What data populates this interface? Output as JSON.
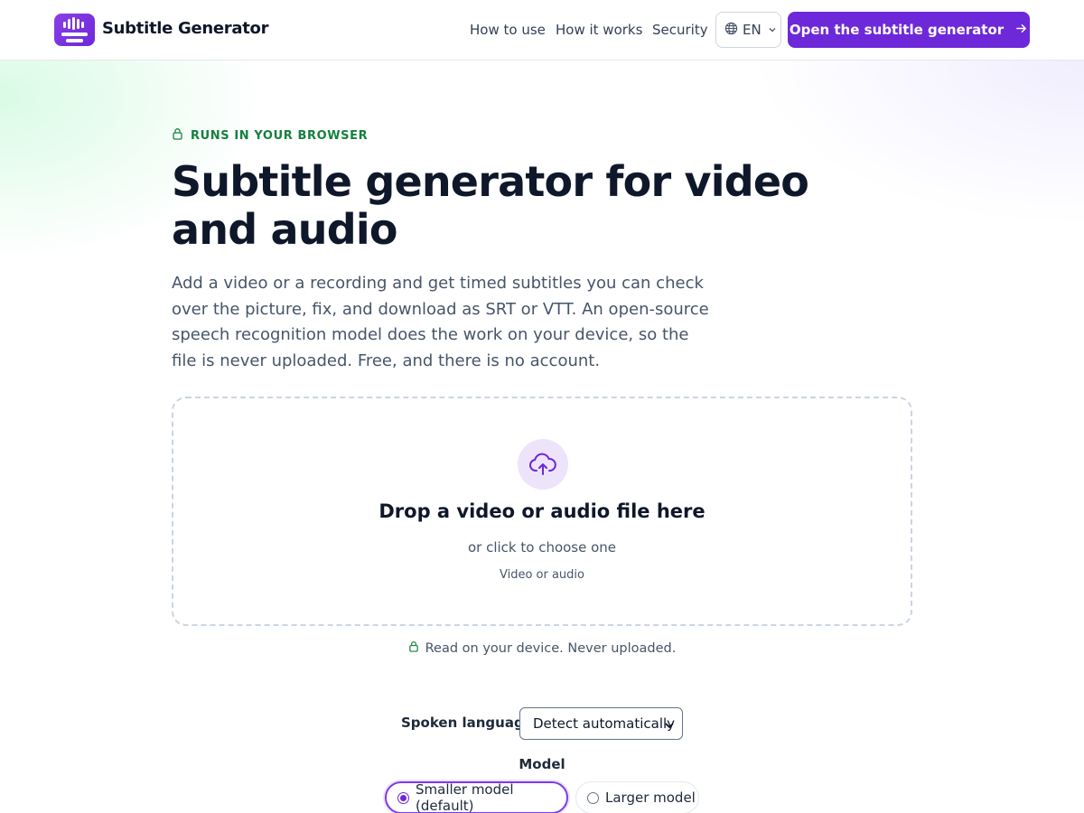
{
  "header": {
    "brand": "Subtitle Generator",
    "nav": [
      {
        "label": "How to use"
      },
      {
        "label": "How it works"
      },
      {
        "label": "Security"
      }
    ],
    "language": {
      "code": "EN",
      "icon": "globe-icon"
    },
    "cta_label": "Open the subtitle generator",
    "cta_icon": "arrow-right-icon"
  },
  "hero": {
    "eyebrow": "RUNS IN YOUR BROWSER",
    "title": "Subtitle generator for video and audio",
    "lead": "Add a video or a recording and get timed subtitles you can check over the picture, fix, and download as SRT or VTT. An open-source speech recognition model does the work on your device, so the file is never uploaded. Free, and there is no account."
  },
  "dropzone": {
    "icon": "upload-cloud-icon",
    "title": "Drop a video or audio file here",
    "subtitle": "or click to choose one",
    "hint": "Video or audio"
  },
  "privacy_note": "Read on your device. Never uploaded.",
  "settings": {
    "language_label": "Spoken language",
    "language_value": "Detect automatically",
    "model_label": "Model",
    "models": [
      {
        "label": "Smaller model (default)",
        "selected": true
      },
      {
        "label": "Larger model",
        "selected": false
      }
    ]
  },
  "colors": {
    "accent": "#6d28d9",
    "eyebrow_green": "#15803d",
    "text_dark": "#0f172a",
    "text_muted": "#475569"
  }
}
